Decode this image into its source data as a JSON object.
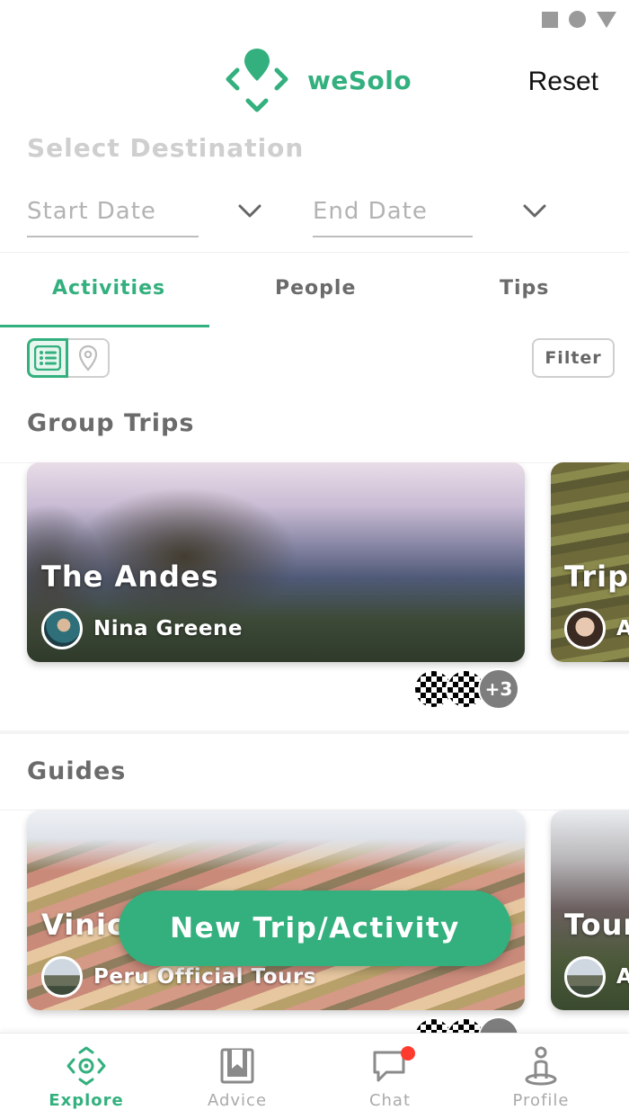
{
  "app": {
    "name": "weSolo",
    "reset_label": "Reset",
    "accent_color": "#33b07e"
  },
  "search": {
    "destination_placeholder": "Select Destination",
    "start_date_placeholder": "Start Date",
    "end_date_placeholder": "End Date"
  },
  "tabs": [
    {
      "label": "Activities",
      "active": true
    },
    {
      "label": "People",
      "active": false
    },
    {
      "label": "Tips",
      "active": false
    }
  ],
  "toolbar": {
    "filter_label": "Filter",
    "view_mode": "list"
  },
  "group_trips": {
    "title": "Group Trips",
    "cards": [
      {
        "title": "The Andes",
        "owner": "Nina Greene",
        "extra_participants": "+3"
      },
      {
        "title": "Trip",
        "owner": "A"
      }
    ]
  },
  "guides": {
    "title": "Guides",
    "cards": [
      {
        "title": "Vinic",
        "owner": "Peru Official Tours"
      },
      {
        "title": "Tour",
        "owner": "A"
      }
    ]
  },
  "fab": {
    "label": "New Trip/Activity"
  },
  "bottom_nav": [
    {
      "label": "Explore",
      "icon": "explore-icon",
      "active": true
    },
    {
      "label": "Advice",
      "icon": "book-icon",
      "active": false
    },
    {
      "label": "Chat",
      "icon": "chat-icon",
      "active": false,
      "has_badge": true
    },
    {
      "label": "Profile",
      "icon": "profile-icon",
      "active": false
    }
  ]
}
